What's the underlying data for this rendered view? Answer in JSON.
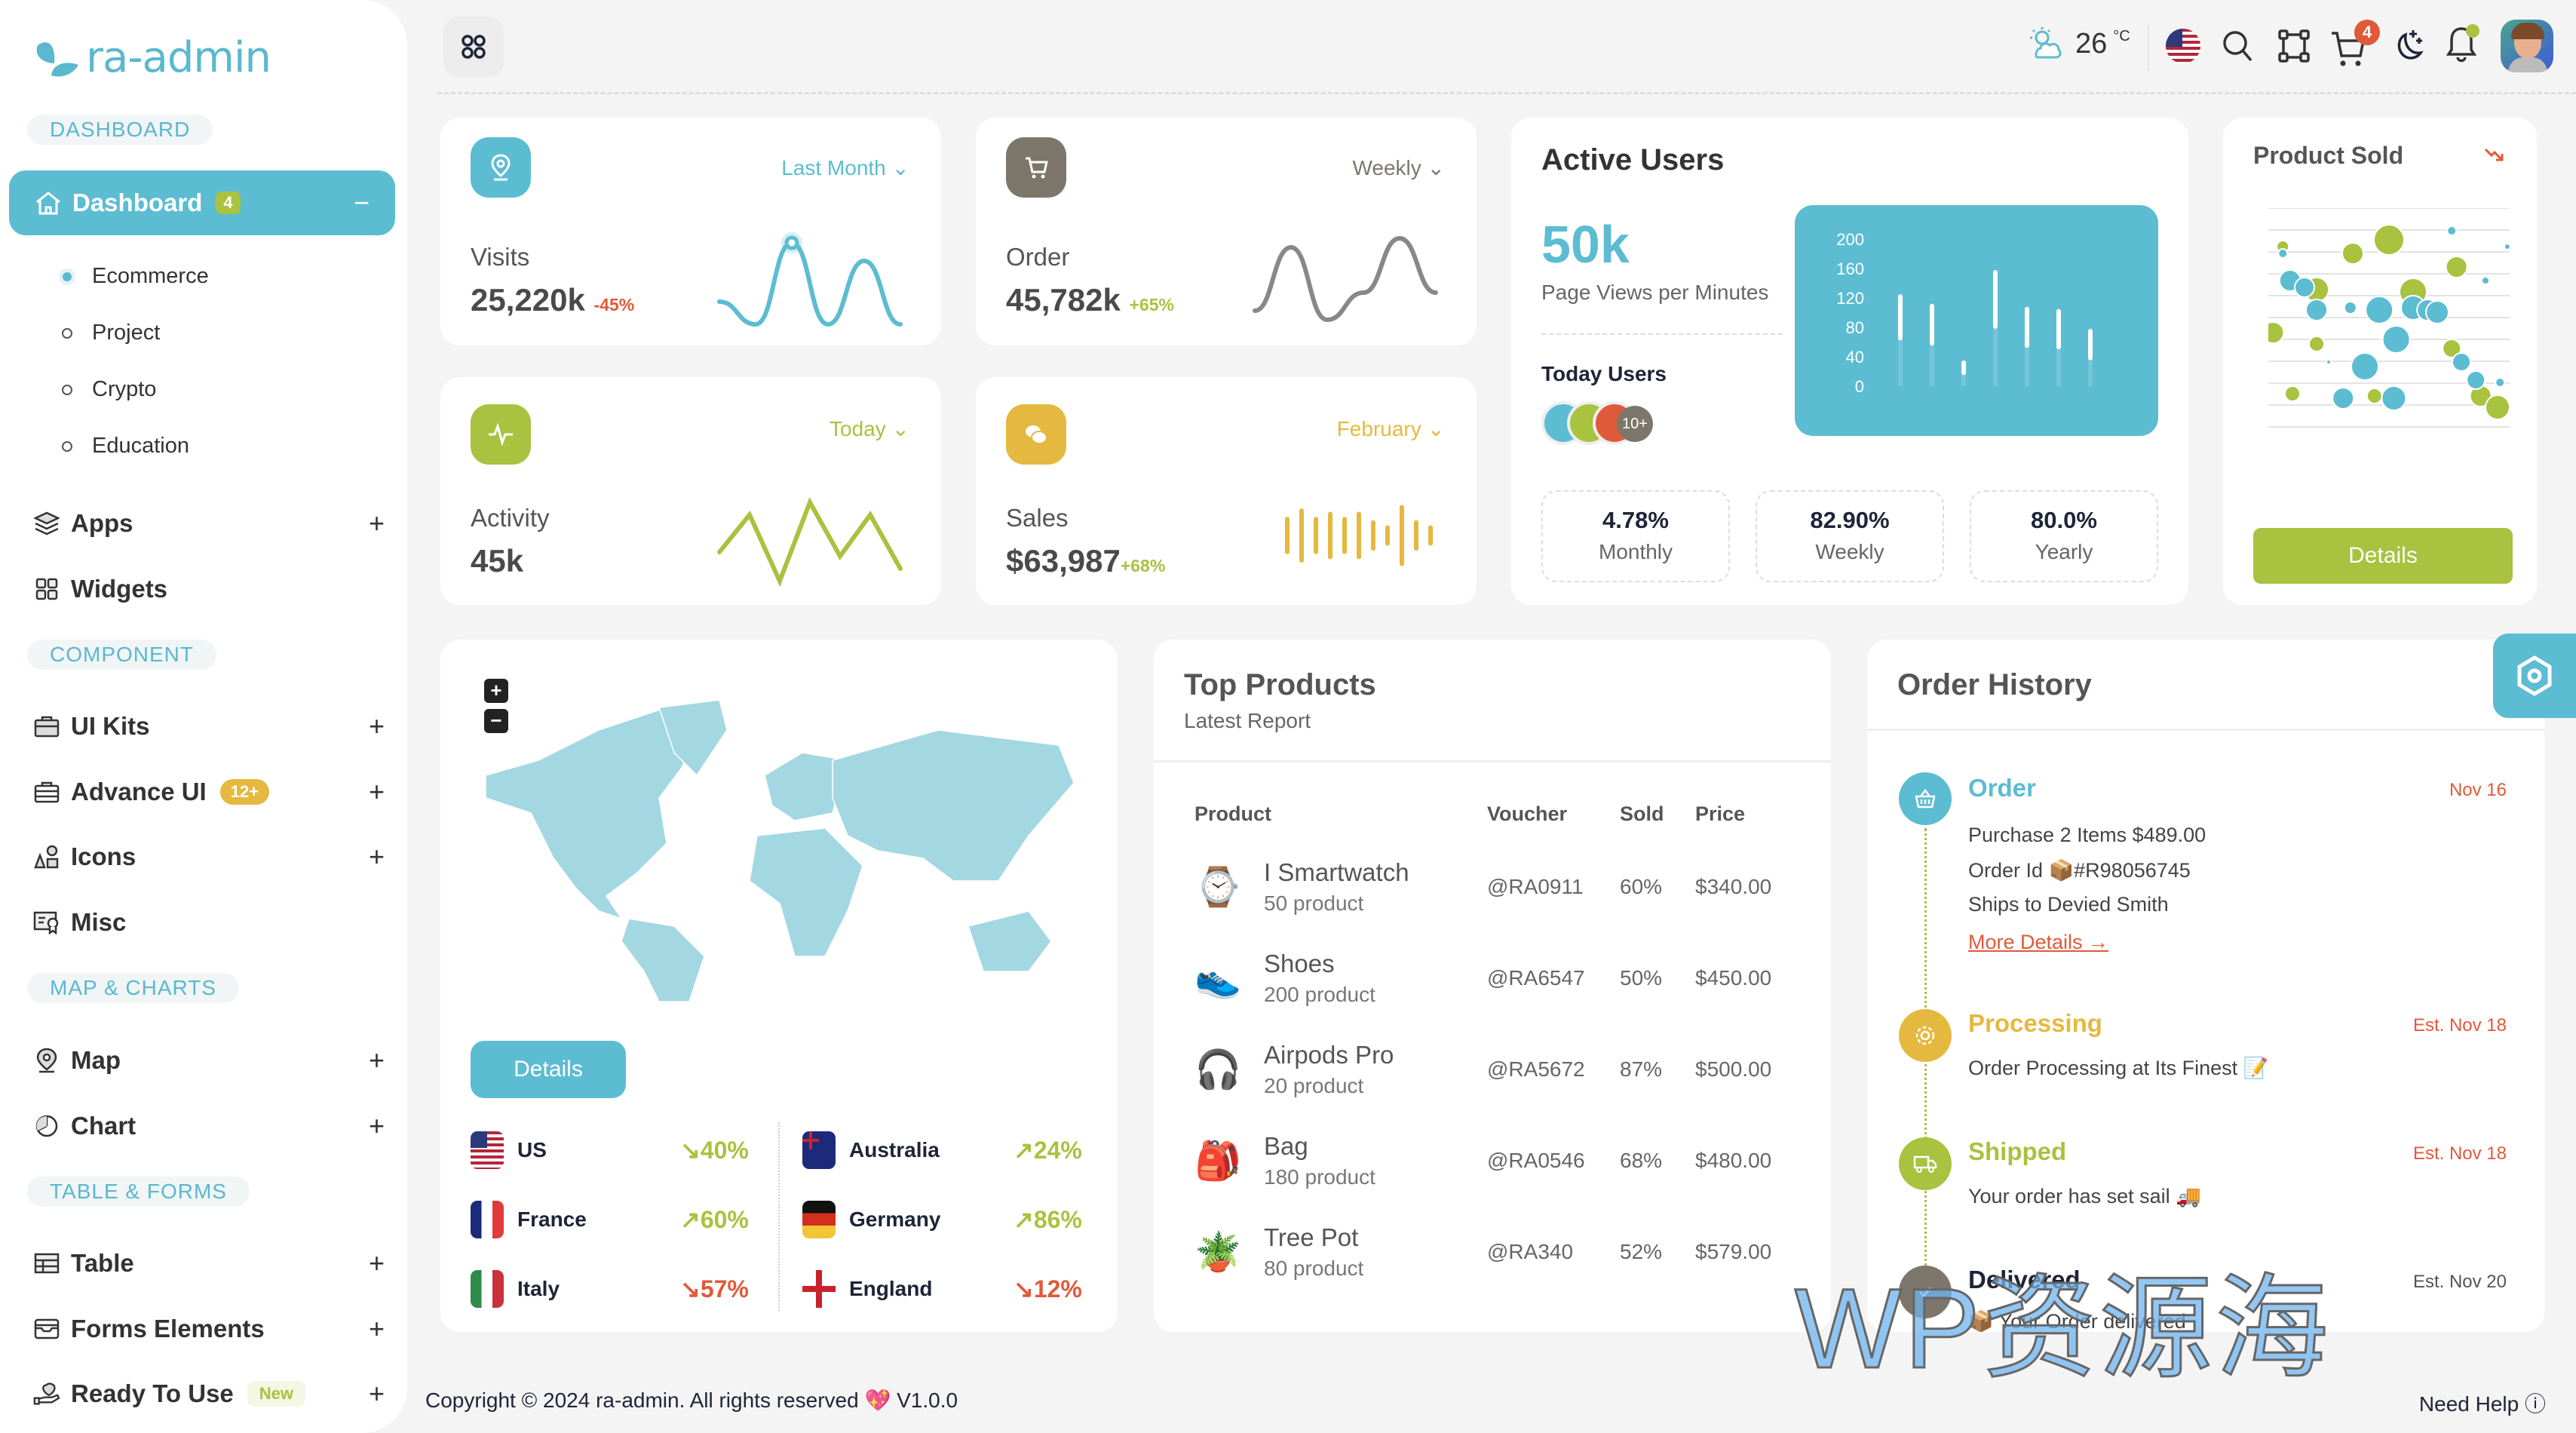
{
  "brand": {
    "name": "ra-admin",
    "color": "#5ab8cf"
  },
  "sidebar": {
    "sections": [
      "DASHBOARD",
      "COMPONENT",
      "MAP & CHARTS",
      "TABLE & FORMS"
    ],
    "active": {
      "label": "Dashboard",
      "badge": "4",
      "toggle": "−"
    },
    "subitems": [
      "Ecommerce",
      "Project",
      "Crypto",
      "Education"
    ],
    "items": [
      {
        "label": "Apps",
        "icon": "layers-icon",
        "expand": "+"
      },
      {
        "label": "Widgets",
        "icon": "grid-icon",
        "expand": ""
      },
      {
        "label": "UI Kits",
        "icon": "briefcase-icon",
        "expand": "+"
      },
      {
        "label": "Advance UI",
        "icon": "suitcase-icon",
        "expand": "+",
        "badge": "12+"
      },
      {
        "label": "Icons",
        "icon": "shapes-icon",
        "expand": "+"
      },
      {
        "label": "Misc",
        "icon": "certificate-icon",
        "expand": ""
      },
      {
        "label": "Map",
        "icon": "map-pin-icon",
        "expand": "+"
      },
      {
        "label": "Chart",
        "icon": "pie-chart-icon",
        "expand": "+"
      },
      {
        "label": "Table",
        "icon": "table-icon",
        "expand": "+"
      },
      {
        "label": "Forms Elements",
        "icon": "inbox-icon",
        "expand": "+"
      },
      {
        "label": "Ready To Use",
        "icon": "hand-heart-icon",
        "expand": "+",
        "badge": "New"
      }
    ]
  },
  "topbar": {
    "weather": {
      "temp": "26",
      "unit": "°C"
    },
    "cart_count": "4"
  },
  "stats": [
    {
      "label": "Visits",
      "value": "25,220k",
      "change": "-45%",
      "period": "Last Month",
      "color": "#5cbcd2",
      "change_color": "#e05a3a"
    },
    {
      "label": "Order",
      "value": "45,782k",
      "change": "+65%",
      "period": "Weekly",
      "color": "#7d776b",
      "change_color": "#a9c23f"
    },
    {
      "label": "Activity",
      "value": "45k",
      "change": "",
      "period": "Today",
      "color": "#a9c23f",
      "change_color": "#a9c23f"
    },
    {
      "label": "Sales",
      "value": "$63,987",
      "change": "+68%",
      "period": "February",
      "color": "#e5b93f",
      "change_color": "#a9c23f"
    }
  ],
  "active_users": {
    "title": "Active Users",
    "value": "50k",
    "subtitle": "Page Views per Minutes",
    "today_label": "Today Users",
    "avatar_more": "10+",
    "metrics": [
      {
        "value": "4.78%",
        "label": "Monthly"
      },
      {
        "value": "82.90%",
        "label": "Weekly"
      },
      {
        "value": "80.0%",
        "label": "Yearly"
      }
    ]
  },
  "product_sold": {
    "title": "Product Sold",
    "button": "Details"
  },
  "map_card": {
    "button": "Details",
    "zoom_in": "+",
    "zoom_out": "−",
    "countries": [
      {
        "name": "US",
        "change": "40%",
        "trend": "down",
        "color": "#a9c23f"
      },
      {
        "name": "Australia",
        "change": "24%",
        "trend": "up",
        "color": "#a9c23f"
      },
      {
        "name": "France",
        "change": "60%",
        "trend": "up",
        "color": "#a9c23f"
      },
      {
        "name": "Germany",
        "change": "86%",
        "trend": "up",
        "color": "#a9c23f"
      },
      {
        "name": "Italy",
        "change": "57%",
        "trend": "down",
        "color": "#e05a3a"
      },
      {
        "name": "England",
        "change": "12%",
        "trend": "down",
        "color": "#e05a3a"
      }
    ]
  },
  "top_products": {
    "title": "Top Products",
    "subtitle": "Latest Report",
    "columns": [
      "Product",
      "Voucher",
      "Sold",
      "Price"
    ],
    "rows": [
      {
        "name": "I Smartwatch",
        "count": "50 product",
        "voucher": "@RA0911",
        "sold": "60%",
        "price": "$340.00",
        "icon": "⌚"
      },
      {
        "name": "Shoes",
        "count": "200 product",
        "voucher": "@RA6547",
        "sold": "50%",
        "price": "$450.00",
        "icon": "👟"
      },
      {
        "name": "Airpods Pro",
        "count": "20 product",
        "voucher": "@RA5672",
        "sold": "87%",
        "price": "$500.00",
        "icon": "🎧"
      },
      {
        "name": "Bag",
        "count": "180 product",
        "voucher": "@RA0546",
        "sold": "68%",
        "price": "$480.00",
        "icon": "🎒"
      },
      {
        "name": "Tree Pot",
        "count": "80 product",
        "voucher": "@RA340",
        "sold": "52%",
        "price": "$579.00",
        "icon": "🪴"
      }
    ]
  },
  "order_history": {
    "title": "Order History",
    "steps": [
      {
        "title": "Order",
        "date": "Nov 16",
        "color": "#5cbcd2",
        "lines": [
          "Purchase 2 Items $489.00",
          "Order Id 📦#R98056745",
          "Ships to Devied Smith"
        ],
        "link": "More Details →"
      },
      {
        "title": "Processing",
        "date": "Est. Nov 18",
        "color": "#e5b93f",
        "lines": [
          "Order Processing at Its Finest 📝"
        ]
      },
      {
        "title": "Shipped",
        "date": "Est. Nov 18",
        "color": "#a9c23f",
        "lines": [
          "Your order has set sail 🚚"
        ]
      },
      {
        "title": "Delivered",
        "date": "Est. Nov 20",
        "color": "#1e2438",
        "lines": [
          "📦 Your Order delivered"
        ]
      }
    ]
  },
  "footer": {
    "copyright": "Copyright © 2024 ra-admin. All rights reserved 💖 V1.0.0",
    "help": "Need Help ⓘ"
  },
  "watermark": "WP资源海",
  "chart_data": [
    {
      "type": "bar",
      "title": "Active Users range",
      "ylim": [
        0,
        200
      ],
      "yticks": [
        0,
        40,
        80,
        120,
        160,
        200
      ],
      "series": [
        {
          "name": "range",
          "low": [
            62,
            55,
            15,
            78,
            52,
            50,
            35
          ],
          "high": [
            125,
            112,
            35,
            158,
            108,
            105,
            78
          ]
        }
      ]
    },
    {
      "type": "scatter",
      "title": "Product Sold bubbles",
      "series": [
        {
          "name": "green",
          "color": "#a9c23f",
          "points": [
            [
              0.06,
              0.83,
              8
            ],
            [
              0.35,
              0.8,
              14
            ],
            [
              0.5,
              0.86,
              20
            ],
            [
              0.6,
              0.63,
              18
            ],
            [
              0.78,
              0.74,
              14
            ],
            [
              0.2,
              0.64,
              16
            ],
            [
              0.02,
              0.45,
              14
            ],
            [
              0.2,
              0.4,
              10
            ],
            [
              0.76,
              0.38,
              12
            ],
            [
              0.1,
              0.18,
              10
            ],
            [
              0.44,
              0.17,
              10
            ],
            [
              0.88,
              0.17,
              14
            ],
            [
              0.95,
              0.12,
              16
            ]
          ]
        },
        {
          "name": "blue",
          "color": "#5cbcd2",
          "points": [
            [
              0.76,
              0.9,
              6
            ],
            [
              0.99,
              0.83,
              4
            ],
            [
              0.06,
              0.8,
              6
            ],
            [
              0.09,
              0.68,
              14
            ],
            [
              0.15,
              0.65,
              13
            ],
            [
              0.2,
              0.55,
              14
            ],
            [
              0.34,
              0.56,
              8
            ],
            [
              0.46,
              0.55,
              18
            ],
            [
              0.6,
              0.56,
              16
            ],
            [
              0.66,
              0.55,
              14
            ],
            [
              0.7,
              0.54,
              15
            ],
            [
              0.53,
              0.42,
              18
            ],
            [
              0.25,
              0.32,
              3
            ],
            [
              0.4,
              0.3,
              18
            ],
            [
              0.8,
              0.32,
              12
            ],
            [
              0.86,
              0.24,
              12
            ],
            [
              0.96,
              0.23,
              6
            ],
            [
              0.31,
              0.16,
              14
            ],
            [
              0.52,
              0.16,
              16
            ],
            [
              0.9,
              0.68,
              5
            ]
          ]
        }
      ]
    },
    {
      "type": "line",
      "title": "Visits",
      "values": [
        30,
        5,
        95,
        5,
        75,
        5
      ]
    },
    {
      "type": "line",
      "title": "Order",
      "values": [
        20,
        90,
        10,
        40,
        100,
        40
      ]
    },
    {
      "type": "line",
      "title": "Activity",
      "values": [
        40,
        85,
        5,
        100,
        35,
        85,
        20
      ]
    },
    {
      "type": "bar",
      "title": "Sales",
      "values": [
        55,
        80,
        55,
        70,
        55,
        70,
        45,
        30,
        90,
        45,
        30
      ]
    }
  ]
}
